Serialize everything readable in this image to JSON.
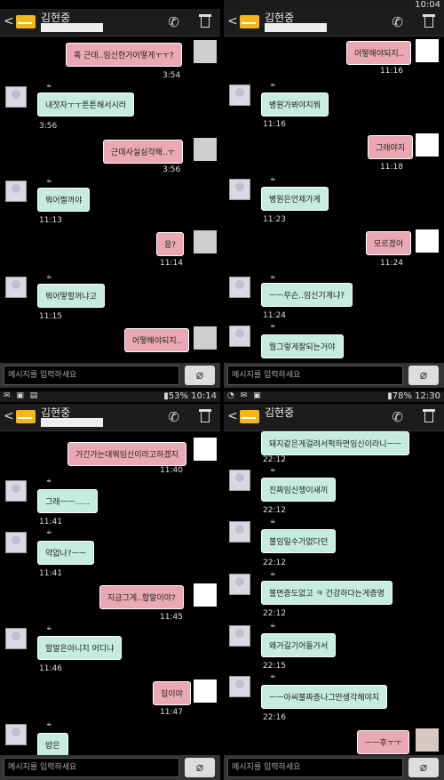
{
  "status": {
    "top_right_time": "10:04",
    "bottom_left": {
      "battery": "53%",
      "time": "10:14"
    },
    "bottom_right": {
      "battery": "78%",
      "time": "12:30"
    }
  },
  "header": {
    "name": "김현중"
  },
  "input_placeholder": "메시지를 입력하세요",
  "icons": {
    "back": "back-arrow-icon",
    "phone": "phone-icon",
    "trash": "trash-icon",
    "attach": "paperclip-icon"
  },
  "panels": [
    {
      "messages": [
        {
          "dir": "sent",
          "text": "혹 근데..임신한거어떻게ㅜㅜ?",
          "time": "3:54"
        },
        {
          "dir": "recv",
          "text": "내젓자ㅜㅜ튼튼해서시러",
          "time": "3:56"
        },
        {
          "dir": "sent",
          "text": "근데사실심각해..ㅜ",
          "time": "3:56"
        },
        {
          "dir": "recv",
          "text": "뭐어쩔꺼야",
          "time": "11:13"
        },
        {
          "dir": "sent",
          "text": "응?",
          "time": "11:14"
        },
        {
          "dir": "recv",
          "text": "뭐어떻할꺼냐고",
          "time": "11:15"
        },
        {
          "dir": "sent",
          "text": "어떻해야되지..",
          "time": ""
        }
      ]
    },
    {
      "messages": [
        {
          "dir": "sent",
          "text": "어떻해야되지..",
          "time": "11:16"
        },
        {
          "dir": "recv",
          "text": "병원가봐야지뭐",
          "time": "11:16"
        },
        {
          "dir": "sent",
          "text": "그래야지",
          "time": "11:18"
        },
        {
          "dir": "recv",
          "text": "병원은언제가게",
          "time": "11:23"
        },
        {
          "dir": "sent",
          "text": "모르겠어",
          "time": "11:24"
        },
        {
          "dir": "recv",
          "text": "ㅡㅡ무슨..임신기계냐?",
          "time": "11:24"
        },
        {
          "dir": "recv",
          "text": "뭘그렇게잘되는거야",
          "time": ""
        }
      ]
    },
    {
      "messages": [
        {
          "dir": "sent",
          "text": "가긴가는대뭐임신이라고하겠지",
          "time": "11:40"
        },
        {
          "dir": "recv",
          "text": "그래ㅡㅡ......",
          "time": "11:41"
        },
        {
          "dir": "recv",
          "text": "약없나?ㅡㅡ",
          "time": "11:41"
        },
        {
          "dir": "sent",
          "text": "지금그게..할말이야?",
          "time": "11:45"
        },
        {
          "dir": "recv",
          "text": "할말은아니지 어디냐",
          "time": "11:46"
        },
        {
          "dir": "sent",
          "text": "집이야",
          "time": "11:47"
        },
        {
          "dir": "recv",
          "text": "밥은",
          "time": ""
        }
      ]
    },
    {
      "messages": [
        {
          "dir": "recv",
          "text": "돼지같은게걸려서퍽하면임신이라니ㅡㅡ",
          "time": "22:12"
        },
        {
          "dir": "recv",
          "text": "진짜임신쟁이새끼",
          "time": "22:12"
        },
        {
          "dir": "recv",
          "text": "불임일수가없다던",
          "time": "22:12"
        },
        {
          "dir": "recv",
          "text": "불면증도없고 ㅋ 건강하다는게증명",
          "time": "22:12"
        },
        {
          "dir": "recv",
          "text": "왜거길기어들가서",
          "time": "22:15"
        },
        {
          "dir": "recv",
          "text": "ㅡㅡ아씨불짜증나그만생각해야지",
          "time": "22:16"
        },
        {
          "dir": "sent",
          "text": "ㅡㅡ후ㅜㅜ",
          "time": ""
        }
      ]
    }
  ]
}
